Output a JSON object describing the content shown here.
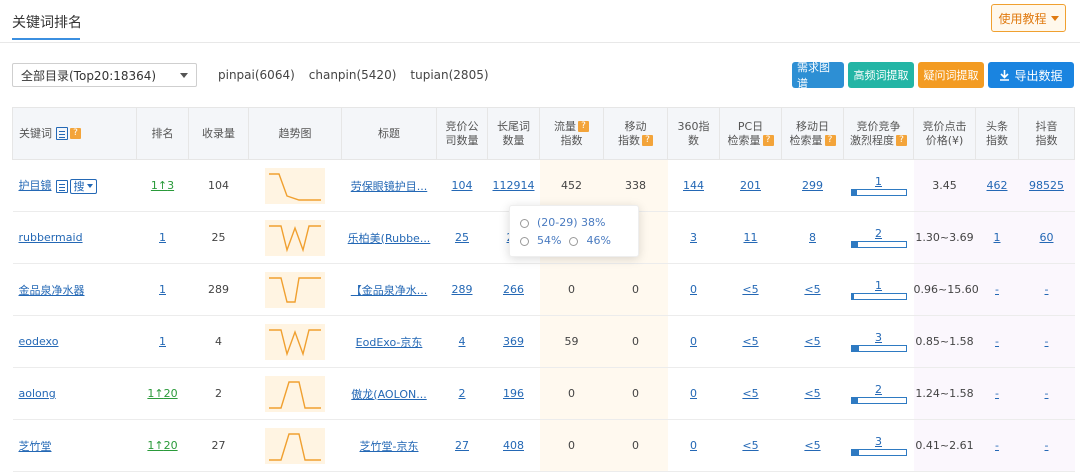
{
  "page": {
    "tab_title": "关键词排名",
    "help_label": "使用教程"
  },
  "toolbar": {
    "catalog_value": "全部目录(Top20:18364)",
    "filters": [
      "pinpai(6064)",
      "chanpin(5420)",
      "tupian(2805)"
    ],
    "actions": [
      "需求图谱",
      "高频词提取",
      "疑问词提取",
      "导出数据"
    ]
  },
  "table": {
    "headers": {
      "keyword": "关键词",
      "rank": "排名",
      "indexed": "收录量",
      "trend": "趋势图",
      "title": "标题",
      "bid_companies_1": "竞价公",
      "bid_companies_2": "司数量",
      "longtail_1": "长尾词",
      "longtail_2": "数量",
      "traffic_1": "流量",
      "traffic_2": "指数",
      "mobile_1": "移动",
      "mobile_2": "指数",
      "i360_1": "360指",
      "i360_2": "数",
      "pc_1": "PC日",
      "pc_2": "检索量",
      "mob_daily_1": "移动日",
      "mob_daily_2": "检索量",
      "compete_1": "竞价竞争",
      "compete_2": "激烈程度",
      "cpc_1": "竞价点击",
      "cpc_2": "价格(¥)",
      "toutiao_1": "头条",
      "toutiao_2": "指数",
      "douyin_1": "抖音",
      "douyin_2": "指数"
    },
    "search_chip_label": "搜",
    "rows": [
      {
        "keyword": "护目镜",
        "rank": "3",
        "rank_up": true,
        "indexed": "104",
        "title": "劳保眼镜护目...",
        "bid": "104",
        "longtail": "112914",
        "traffic": "452",
        "mobile": "338",
        "i360": "144",
        "pc": "201",
        "mob_daily": "299",
        "compete": "1",
        "compete_level": 0.1,
        "cpc": "3.45",
        "toutiao": "462",
        "douyin": "98525"
      },
      {
        "keyword": "rubbermaid",
        "rank": "1",
        "rank_up": false,
        "indexed": "25",
        "title": "乐柏美(Rubbe...",
        "bid": "25",
        "longtail": "22",
        "traffic": "",
        "mobile": "",
        "i360": "3",
        "pc": "11",
        "mob_daily": "8",
        "compete": "2",
        "compete_level": 0.12,
        "cpc": "1.30~3.69",
        "toutiao": "1",
        "douyin": "60"
      },
      {
        "keyword": "金品泉净水器",
        "rank": "1",
        "rank_up": false,
        "indexed": "289",
        "title": "【金品泉净水...",
        "bid": "289",
        "longtail": "266",
        "traffic": "0",
        "mobile": "0",
        "i360": "0",
        "pc": "<5",
        "mob_daily": "<5",
        "compete": "1",
        "compete_level": 0.04,
        "cpc": "0.96~15.60",
        "toutiao": "-",
        "douyin": "-"
      },
      {
        "keyword": "eodexo",
        "rank": "1",
        "rank_up": false,
        "indexed": "4",
        "title": "EodExo-京东",
        "bid": "4",
        "longtail": "369",
        "traffic": "59",
        "mobile": "0",
        "i360": "0",
        "pc": "<5",
        "mob_daily": "<5",
        "compete": "3",
        "compete_level": 0.14,
        "cpc": "0.85~1.58",
        "toutiao": "-",
        "douyin": "-"
      },
      {
        "keyword": "aolong",
        "rank": "20",
        "rank_up": true,
        "indexed": "2",
        "title": "傲龙(AOLON...",
        "bid": "2",
        "longtail": "196",
        "traffic": "0",
        "mobile": "0",
        "i360": "0",
        "pc": "<5",
        "mob_daily": "<5",
        "compete": "2",
        "compete_level": 0.12,
        "cpc": "1.24~1.58",
        "toutiao": "-",
        "douyin": "-"
      },
      {
        "keyword": "芝竹堂",
        "rank": "20",
        "rank_up": true,
        "indexed": "27",
        "title": "芝竹堂-京东",
        "bid": "27",
        "longtail": "408",
        "traffic": "0",
        "mobile": "0",
        "i360": "0",
        "pc": "<5",
        "mob_daily": "<5",
        "compete": "3",
        "compete_level": 0.14,
        "cpc": "0.41~2.61",
        "toutiao": "-",
        "douyin": "-"
      }
    ]
  },
  "tooltip": {
    "age": "(20-29) 38%",
    "male": "54%",
    "female": "46%"
  },
  "colors": {
    "accent": "#2468b5",
    "up": "#2a9a3a",
    "orange": "#f39b22",
    "trend": "#f0a030"
  }
}
